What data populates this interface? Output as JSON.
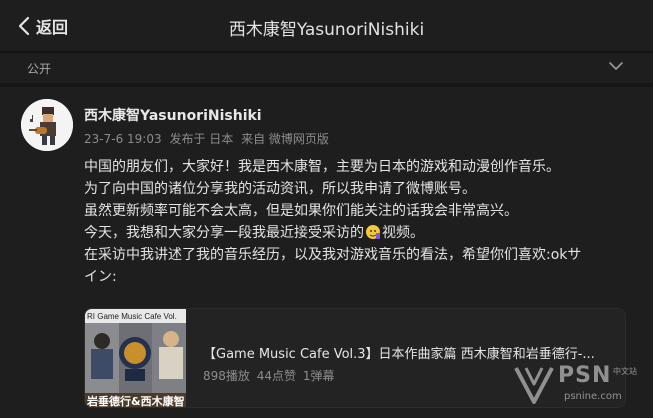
{
  "header": {
    "back_label": "返回",
    "title": "西木康智YasunoriNishiki"
  },
  "visibility": {
    "label": "公开"
  },
  "post": {
    "author": "西木康智YasunoriNishiki",
    "time": "23-7-6 19:03",
    "posted_from_label": "发布于 日本",
    "source": "来自 微博网页版",
    "lines": [
      "中国的朋友们，大家好！我是西木康智，主要为日本的游戏和动漫创作音乐。",
      "为了向中国的诸位分享我的活动资讯，所以我申请了微博账号。",
      "虽然更新频率可能不会太高，但是如果你们能关注的话我会非常高兴。",
      "今天，我想和大家分享一段我最近接受采访的",
      "视频。",
      "在采访中我讲述了我的音乐经历，以及我对游戏音乐的看法，希望你们喜欢:okサ",
      "イン:"
    ],
    "video": {
      "title": "【Game Music Cafe Vol.3】日本作曲家篇 西木康智和岩垂德行-...",
      "plays": "898播放",
      "likes": "44点赞",
      "comments": "1弹幕",
      "thumb_banner": "RI Game Music Cafe Vol.",
      "thumb_caption": "岩垂德行&西木康智"
    }
  },
  "watermark": {
    "brand": "PSN",
    "brand_cn": "中文站",
    "url": "psnine.com"
  }
}
